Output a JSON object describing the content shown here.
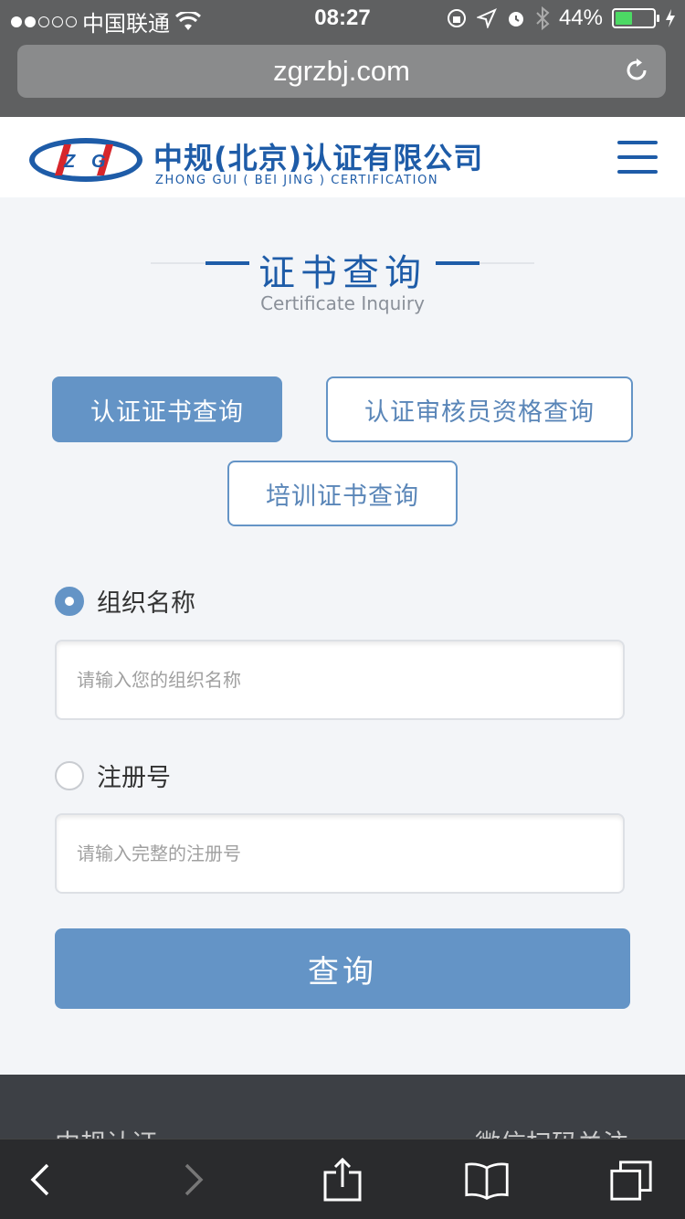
{
  "status_bar": {
    "carrier": "中国联通",
    "time": "08:27",
    "battery": "44%",
    "battery_level": 0.44,
    "signal_icon": "signal-dots-icon",
    "wifi_icon": "wifi-icon"
  },
  "browser": {
    "url": "zgrzbj.com",
    "reload_icon": "reload-icon"
  },
  "site": {
    "brand_cn": "中规(北京)认证有限公司",
    "brand_en": "ZHONG GUI ( BEI JING ) CERTIFICATION",
    "logo_text": "ZG",
    "menu_icon": "hamburger-menu-icon",
    "brand_color": "#1e5ca8"
  },
  "section": {
    "title_cn": "证书查询",
    "title_en": "Certificate Inquiry"
  },
  "tabs": [
    {
      "label": "认证证书查询",
      "active": true
    },
    {
      "label": "认证审核员资格查询",
      "active": false
    },
    {
      "label": "培训证书查询",
      "active": false
    }
  ],
  "form": {
    "org_label": "组织名称",
    "org_placeholder": "请输入您的组织名称",
    "reg_label": "注册号",
    "reg_placeholder": "请输入完整的注册号",
    "submit_label": "查询",
    "selected": "org"
  },
  "footer": {
    "left_text": "中规认证",
    "right_text": "微信扫码关注"
  },
  "toolbar": {
    "back_icon": "back-icon",
    "forward_icon": "forward-icon",
    "share_icon": "share-icon",
    "bookmarks_icon": "bookmarks-icon",
    "tabs_icon": "tabs-icon"
  }
}
